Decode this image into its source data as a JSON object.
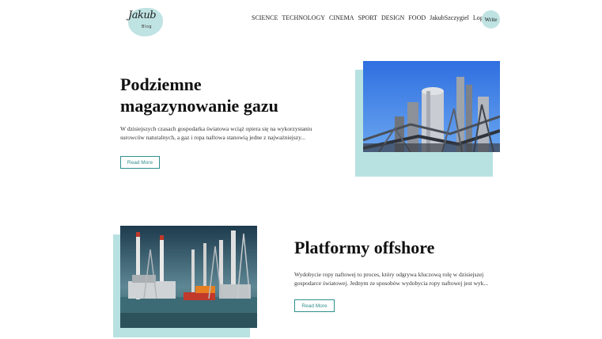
{
  "header": {
    "logo": {
      "text": "Jakub",
      "sub": "Blog"
    },
    "nav": [
      "SCIENCE",
      "TECHNOLOGY",
      "CINEMA",
      "SPORT",
      "DESIGN",
      "FOOD",
      "JakubSzczygiel",
      "Logout"
    ],
    "write_label": "Write"
  },
  "posts": [
    {
      "title_line1": "Podziemne",
      "title_line2": "magazynowanie gazu",
      "excerpt": "W dzisiejszych czasach gospodarka światowa wciąż opiera się na wykorzystaniu surowców naturalnych, a gaz i ropa naftowa stanowią jedne z najważniejszy...",
      "read_more": "Read More",
      "image": "refinery-photo"
    },
    {
      "title": "Platformy offshore",
      "excerpt": "Wydobycie ropy naftowej to proces, który odgrywa kluczową rolę w dzisiejszej gospodarce światowej. Jednym ze sposobów wydobycia ropy naftowej jest wyk...",
      "read_more": "Read More",
      "image": "offshore-rigs-photo"
    }
  ],
  "colors": {
    "accent": "#b8e2e1",
    "button_text": "#2f8f8d"
  }
}
